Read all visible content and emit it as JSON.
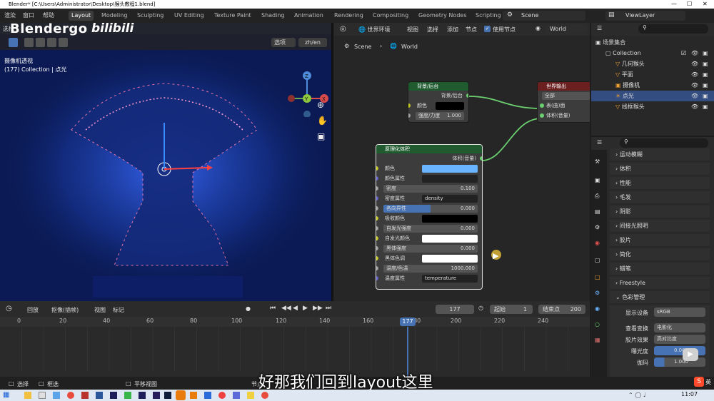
{
  "titlebar": {
    "title": "Blender* [C:\\Users\\Administrator\\Desktop\\猴头教程1.blend]"
  },
  "menubar": {
    "menus": [
      "渲染",
      "窗口",
      "帮助"
    ],
    "workspaces": [
      "Layout",
      "Modeling",
      "Sculpting",
      "UV Editing",
      "Texture Paint",
      "Shading",
      "Animation",
      "Rendering",
      "Compositing",
      "Geometry Nodes",
      "Scripting"
    ],
    "scene": "Scene",
    "viewlayer": "ViewLayer"
  },
  "viewport": {
    "select_label": "选择",
    "watermark": "Blendergo",
    "watermark2": "bilibili",
    "options_label": "选项",
    "lang_button": "zh/en",
    "overlay_title": "摄像机透视",
    "overlay_sub": "(177) Collection | 点光",
    "gizmo_axes": [
      "Z",
      "X",
      "Y"
    ]
  },
  "node_editor": {
    "world_env_label": "世界环境",
    "menus": [
      "视图",
      "选择",
      "添加",
      "节点"
    ],
    "use_nodes_label": "使用节点",
    "world_name": "World",
    "breadcrumb": [
      "Scene",
      "World"
    ],
    "background_node": {
      "title": "背景/后台",
      "output": "背景/后台",
      "color_label": "颜色",
      "strength_label": "强度/力度",
      "strength_value": "1.000"
    },
    "world_output_node": {
      "title": "世界输出",
      "target": "全部",
      "inputs": [
        "表(曲)面",
        "体积(音量)"
      ]
    },
    "volume_node": {
      "title": "原理化体积",
      "output": "体积(音量)",
      "rows": [
        {
          "label": "颜色",
          "value": ""
        },
        {
          "label": "颜色属性",
          "value": ""
        },
        {
          "label": "密度",
          "value": "0.100"
        },
        {
          "label": "密度属性",
          "value": "density"
        },
        {
          "label": "各向异性",
          "value": "0.000"
        },
        {
          "label": "吸收颜色",
          "value": ""
        },
        {
          "label": "自发光强度",
          "value": "0.000"
        },
        {
          "label": "自发光颜色",
          "value": ""
        },
        {
          "label": "黑体强度",
          "value": "0.000"
        },
        {
          "label": "黑体色调",
          "value": ""
        },
        {
          "label": "温度/色温",
          "value": "1000.000"
        },
        {
          "label": "温度属性",
          "value": "temperature"
        }
      ]
    }
  },
  "timeline": {
    "menus": [
      "回放",
      "抠像(插帧)",
      "视图",
      "标记"
    ],
    "current_frame": "177",
    "start_label": "起始",
    "start_value": "1",
    "end_label": "结束点",
    "end_value": "200",
    "ticks": [
      "0",
      "20",
      "40",
      "60",
      "80",
      "100",
      "120",
      "140",
      "160",
      "180",
      "200",
      "220",
      "240"
    ],
    "playhead_label": "177"
  },
  "statusbar": {
    "items": [
      "选择",
      "框选",
      "平移视图",
      "节点"
    ],
    "subtitle": "好那我们回到layout这里"
  },
  "outliner": {
    "root": "场景集合",
    "collection": "Collection",
    "items": [
      "几何猴头",
      "平面",
      "摄像机",
      "点光",
      "线框猴头"
    ]
  },
  "properties": {
    "panels": [
      "运动模糊",
      "体积",
      "性能",
      "毛发",
      "阴影",
      "间接光照明",
      "胶片",
      "简化",
      "蜡笔",
      "Freestyle",
      "色彩管理"
    ],
    "display_device_label": "显示设备",
    "display_device_value": "sRGB",
    "view_transform_label": "查看变换",
    "view_transform_value": "电影化",
    "look_label": "胶片效果",
    "look_value": "高对比度",
    "exposure_label": "曝光度",
    "exposure_value": "0.000",
    "gamma_label": "伽玛",
    "gamma_value": "1.000"
  },
  "taskbar": {
    "time": "11:07",
    "ime": "英"
  },
  "colors": {
    "accent": "#4772b3",
    "node_green": "#6bd170",
    "volume_blue": "#6ab4ff"
  }
}
